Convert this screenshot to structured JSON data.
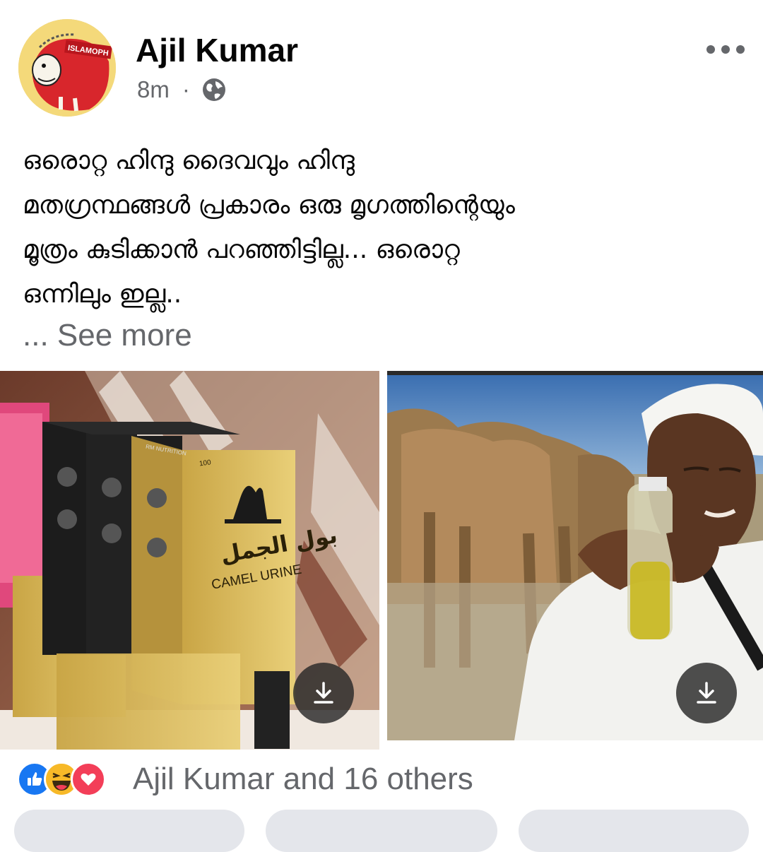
{
  "post": {
    "author": "Ajil Kumar",
    "time": "8m",
    "separator": "·",
    "privacy_icon": "globe-icon",
    "avatar_label": "ISLAMOPH",
    "text_lines": [
      "ഒരൊറ്റ ഹിന്ദു ദൈവവും ഹിന്ദു",
      "മതഗ്രന്ഥങ്ങൾ പ്രകാരം ഒരു മൃഗത്തിന്റെയും",
      "മൂത്രം കുടിക്കാൻ പറഞ്ഞിട്ടില്ല... ഒരൊറ്റ",
      "ഒന്നിലും ഇല്ല.."
    ],
    "see_more": "... See more"
  },
  "photos": {
    "photo1": {
      "box_front_arabic": "بول الجمل",
      "box_front_english": "CAMEL URINE",
      "box_weight": "100",
      "box_brand": "RM NUTRITION"
    },
    "photo2": {}
  },
  "reactions": {
    "icons": [
      "like-icon",
      "haha-icon",
      "love-icon"
    ],
    "summary": "Ajil Kumar and 16 others"
  },
  "colors": {
    "secondary_text": "#65676b",
    "like_blue": "#1877f2",
    "love_red": "#f33e58",
    "haha_yellow": "#f7b928"
  }
}
